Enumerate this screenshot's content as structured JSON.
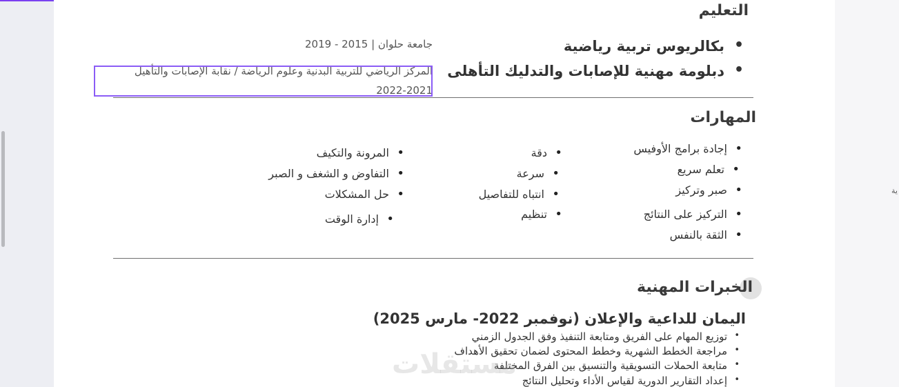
{
  "education": {
    "heading": "التعليم",
    "degrees": [
      {
        "title": "بكالريوس تربية رياضية",
        "detail": "جامعة حلوان | 2015 - 2019"
      },
      {
        "title": "دبلومة مهنية للإصابات والتدليك التأهلى",
        "detail_line1": "المركز الرياضي للتربية البدنية وعلوم الرياضة / نقابة الإصابات والتأهيل",
        "detail_line2": "2022-2021"
      }
    ]
  },
  "skills": {
    "heading": "المهارات",
    "col1": [
      "إجادة برامج الأوفيس",
      "تعلم سريع",
      "صبر وتركيز",
      "التركيز على النتائج",
      "الثقة بالنفس"
    ],
    "col2": [
      "دقة",
      "سرعة",
      "انتباه للتفاصيل",
      "تنظيم"
    ],
    "col3": [
      "المرونة والتكيف",
      "التفاوض و الشغف و الصبر",
      "حل المشكلات",
      "إدارة الوقت"
    ]
  },
  "experience": {
    "heading": "الخبرات المهنية",
    "job_title": "اليمان للداعية والإعلان  (نوفمبر 2022- مارس 2025)",
    "duties": [
      "توزيع المهام على الفريق ومتابعة التنفيذ وفق الجدول الزمني",
      "مراجعة الخطط الشهرية وخطط المحتوى لضمان تحقيق الأهداف",
      "متابعة الحملات التسويقية والتنسيق بين الفرق المختلفة",
      "إعداد التقارير الدورية لقياس الأداء وتحليل النتائج"
    ]
  },
  "watermark": "مستقلات",
  "side_fragment": "ية"
}
